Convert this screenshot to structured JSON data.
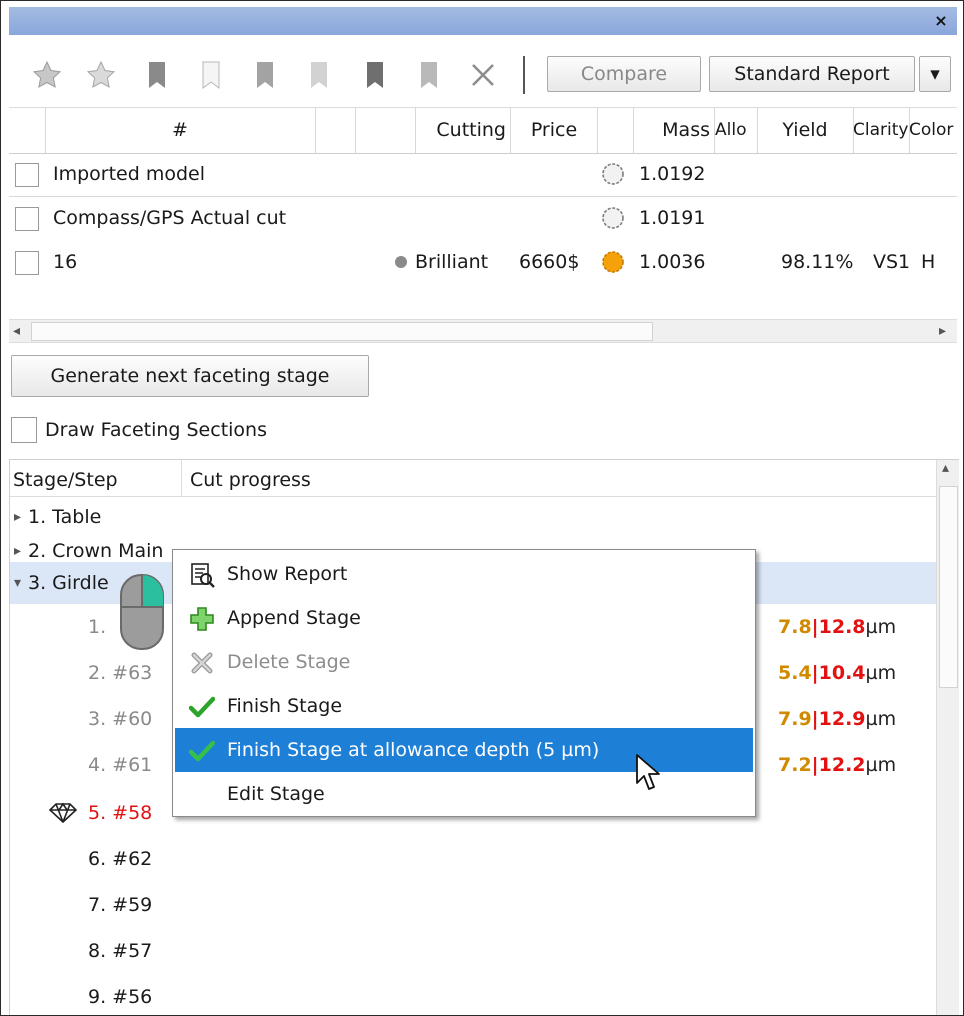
{
  "window": {
    "close_glyph": "×"
  },
  "toolbar": {
    "icons": [
      "star-icon",
      "star-icon",
      "bookmark-dark-icon",
      "bookmark-outline-icon",
      "bookmark-gray-icon",
      "bookmark-light-icon",
      "bookmark-darkest-icon",
      "bookmark-lightgray-icon",
      "close-x-icon"
    ],
    "compare_label": "Compare",
    "report_label": "Standard Report",
    "report_dropdown_glyph": "▾"
  },
  "grid": {
    "headers": [
      "#",
      "Cutting",
      "Price",
      "Mass",
      "Allo",
      "Yield",
      "Clarity",
      "Color"
    ],
    "rows": [
      {
        "name": "Imported model",
        "cutting": "",
        "price": "",
        "mass": "1.0192",
        "yield": "",
        "clarity": "",
        "color": ""
      },
      {
        "name": "Compass/GPS Actual cut",
        "cutting": "",
        "price": "",
        "mass": "1.0191",
        "yield": "",
        "clarity": "",
        "color": ""
      },
      {
        "name": "16",
        "cutting": "Brilliant",
        "price": "6660$",
        "mass": "1.0036",
        "yield": "98.11%",
        "clarity": "VS1",
        "color": "H"
      }
    ],
    "scroll_left_glyph": "◂",
    "scroll_right_glyph": "▸"
  },
  "actions": {
    "generate_label": "Generate next faceting stage",
    "draw_sections_label": "Draw Faceting Sections"
  },
  "tree": {
    "col_stage": "Stage/Step",
    "col_progress": "Cut progress",
    "collapsed_glyph": "▸",
    "expanded_glyph": "▾",
    "scroll_up_glyph": "▴",
    "items": [
      {
        "label": "1. Table"
      },
      {
        "label": "2. Crown Main"
      },
      {
        "label": "3. Girdle"
      }
    ],
    "steps": [
      {
        "label": "1.",
        "v1": "7.8",
        "sep": "|",
        "v2": "12.8",
        "unit": "µm"
      },
      {
        "label": "2. #63",
        "v1": "5.4",
        "sep": "|",
        "v2": "10.4",
        "unit": "µm"
      },
      {
        "label": "3. #60",
        "v1": "7.9",
        "sep": "|",
        "v2": "12.9",
        "unit": "µm"
      },
      {
        "label": "4. #61",
        "v1": "7.2",
        "sep": "|",
        "v2": "12.2",
        "unit": "µm"
      },
      {
        "label": "5. #58"
      },
      {
        "label": "6. #62"
      },
      {
        "label": "7. #59"
      },
      {
        "label": "8. #57"
      },
      {
        "label": "9. #56"
      }
    ]
  },
  "context_menu": {
    "items": [
      {
        "label": "Show Report",
        "icon": "report-icon"
      },
      {
        "label": "Append Stage",
        "icon": "plus-icon"
      },
      {
        "label": "Delete Stage",
        "icon": "delete-icon",
        "disabled": true
      },
      {
        "label": "Finish Stage",
        "icon": "check-icon"
      },
      {
        "label": "Finish Stage at allowance depth (5 µm)",
        "icon": "check-icon",
        "highlighted": true
      },
      {
        "label": "Edit Stage",
        "icon": ""
      }
    ]
  },
  "colors": {
    "accent": "#1e7fd6",
    "orange": "#d18a00",
    "red": "#e21212",
    "selection": "#dbe7f7"
  }
}
